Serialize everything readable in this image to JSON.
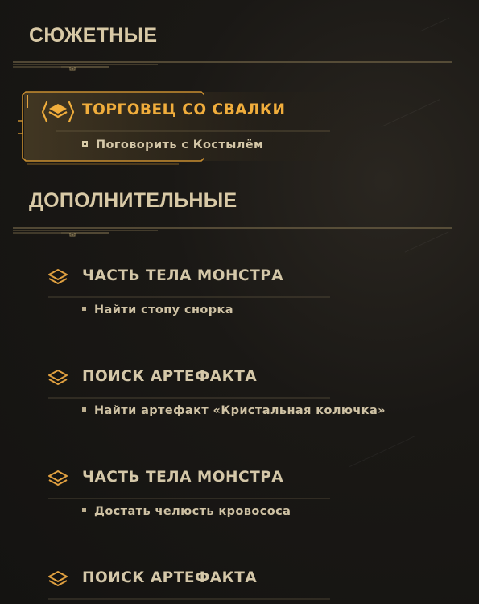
{
  "sections": {
    "story_title": "СЮЖЕТНЫЕ",
    "extra_title": "ДОПОЛНИТЕЛЬНЫЕ"
  },
  "story_quests": [
    {
      "title": "ТОРГОВЕЦ СО СВАЛКИ",
      "objective": "Поговорить с Костылём",
      "active": true,
      "icon": "quest-stack-icon"
    }
  ],
  "extra_quests": [
    {
      "title": "ЧАСТЬ ТЕЛА МОНСТРА",
      "objective": "Найти стопу снорка",
      "icon": "quest-stack-icon"
    },
    {
      "title": "ПОИСК АРТЕФАКТА",
      "objective": "Найти артефакт «Кристальная колючка»",
      "icon": "quest-stack-icon"
    },
    {
      "title": "ЧАСТЬ ТЕЛА МОНСТРА",
      "objective": "Достать челюсть кровососа",
      "icon": "quest-stack-icon"
    },
    {
      "title": "ПОИСК АРТЕФАКТА",
      "icon": "quest-stack-icon"
    }
  ],
  "colors": {
    "active_accent": "#f0ad3c",
    "text": "#d4c7a8",
    "section_title": "#d8c9a6",
    "background": "#1a1815"
  }
}
